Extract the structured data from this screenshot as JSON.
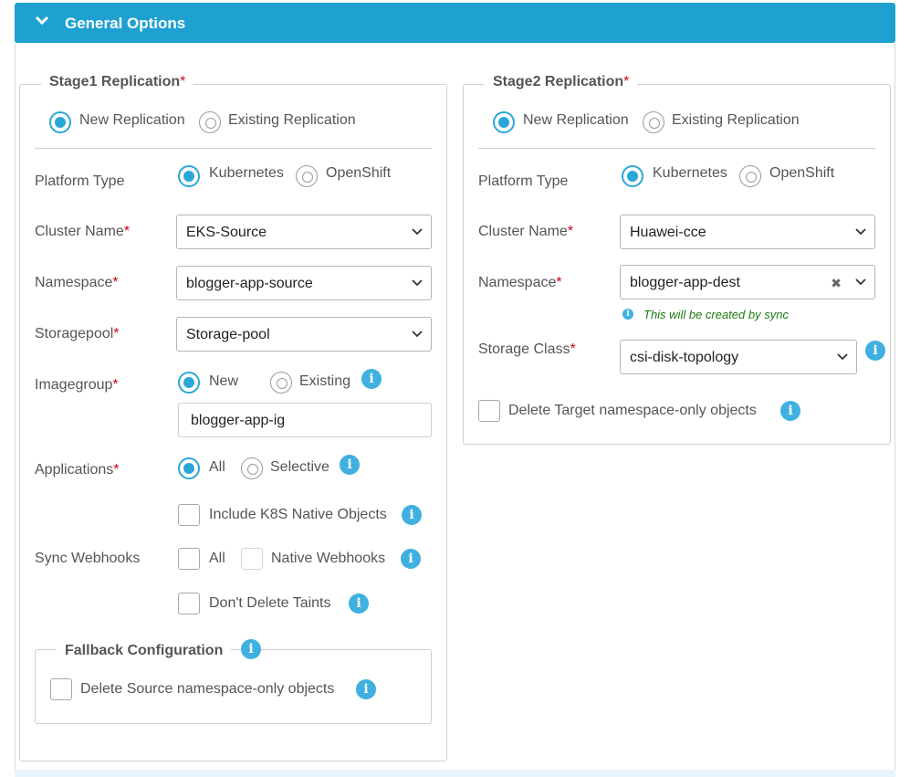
{
  "header": {
    "title": "General Options",
    "color": "#1ea1d1"
  },
  "stage1": {
    "title": "Stage1 Replication",
    "required": "*",
    "mode_new": "New Replication",
    "mode_existing": "Existing Replication",
    "platform_label": "Platform Type",
    "platform_kubernetes": "Kubernetes",
    "platform_openshift": "OpenShift",
    "cluster_label": "Cluster Name",
    "cluster_value": "EKS-Source",
    "namespace_label": "Namespace",
    "namespace_value": "blogger-app-source",
    "storagepool_label": "Storagepool",
    "storagepool_value": "Storage-pool",
    "imagegroup_label": "Imagegroup",
    "imagegroup_new": "New",
    "imagegroup_existing": "Existing",
    "imagegroup_value": "blogger-app-ig",
    "applications_label": "Applications",
    "applications_all": "All",
    "applications_selective": "Selective",
    "include_k8s": "Include K8S Native Objects",
    "webhooks_label": "Sync Webhooks",
    "webhooks_all": "All",
    "webhooks_native": "Native Webhooks",
    "dont_delete_taints": "Don't Delete Taints",
    "fallback_title": "Fallback Configuration",
    "delete_source_ns": "Delete Source namespace-only objects"
  },
  "stage2": {
    "title": "Stage2 Replication",
    "required": "*",
    "mode_new": "New Replication",
    "mode_existing": "Existing Replication",
    "platform_label": "Platform Type",
    "platform_kubernetes": "Kubernetes",
    "platform_openshift": "OpenShift",
    "cluster_label": "Cluster Name",
    "cluster_value": "Huawei-cce",
    "namespace_label": "Namespace",
    "namespace_value": "blogger-app-dest",
    "namespace_hint": "This will be created by sync",
    "storageclass_label": "Storage Class",
    "storageclass_value": "csi-disk-topology",
    "delete_target_ns": "Delete Target namespace-only objects"
  },
  "icons": {
    "info": "i",
    "clear": "✖"
  },
  "colors": {
    "accent": "#2aa7d8",
    "required": "#d0021b",
    "hint": "#1a7a12"
  }
}
